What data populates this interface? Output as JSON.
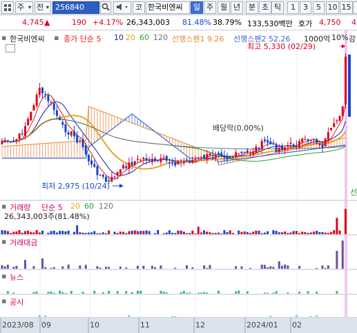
{
  "toolbar": {
    "menu_icon": "grid-menu-icon",
    "market_label": "주",
    "type_label": "전",
    "code": "256840",
    "search_icon": "search-icon",
    "speaker_icon": "speaker-icon",
    "link_label": "코",
    "name": "한국비엔씨",
    "periods": [
      "일",
      "주",
      "월",
      "년",
      "분",
      "초",
      "틱"
    ],
    "selected_period": "일",
    "intervals": [
      "1",
      "3",
      "5",
      "10",
      "15",
      "3"
    ]
  },
  "quote": {
    "price": "4,745",
    "arrow": "▲",
    "change": "190",
    "change_pct": "+4.17%",
    "volume": "26,343,003",
    "volume_ratio": "81.48%",
    "turnover": "38.79%",
    "amount": "133,530백만",
    "hoga_label": "호가",
    "hoga_value": "4,750",
    "extra": "4"
  },
  "price_panel": {
    "title": "한국비엔씨",
    "legend": {
      "close_ma": "종가 단순 5",
      "ma10": "10",
      "ma20": "20",
      "ma60": "60",
      "ma120": "120",
      "span1": "선행스팬1 9.26",
      "span2": "선행스팬2 52.26",
      "unit": "1000억",
      "pct": "10%",
      "extra": "강"
    },
    "high_label": "최고 5,330 (02/29)",
    "low_label": "최저 2,975 (10/24)",
    "dividend_label": "배당락(0.00%)",
    "right_cut": "선"
  },
  "volume_panel": {
    "title": "거래량",
    "legend": {
      "ma": "단순 5",
      "ma20": "20",
      "ma60": "60",
      "ma120": "120"
    },
    "value": "26,343,003주(81.48%)"
  },
  "amount_panel": {
    "title": "거래대금"
  },
  "news_panel": {
    "title": "뉴스"
  },
  "disclosure_panel": {
    "title": "공시"
  },
  "axis": {
    "labels": [
      "2023/08",
      "09",
      "10",
      "11",
      "12",
      "2024/01",
      "02"
    ]
  },
  "colors": {
    "up": "#e0001b",
    "down": "#1846c8",
    "ma5": "#e41b1b",
    "ma10": "#1c1c8a",
    "ma20": "#f0a020",
    "ma60": "#2a9d3b",
    "ma120": "#6e6e6e",
    "span1": "#e08a3a",
    "span2": "#3a6ad8",
    "cloud_up": "#f2a06a",
    "cloud_down": "#6f8fe6",
    "highlight": "#f0c8f0"
  }
}
